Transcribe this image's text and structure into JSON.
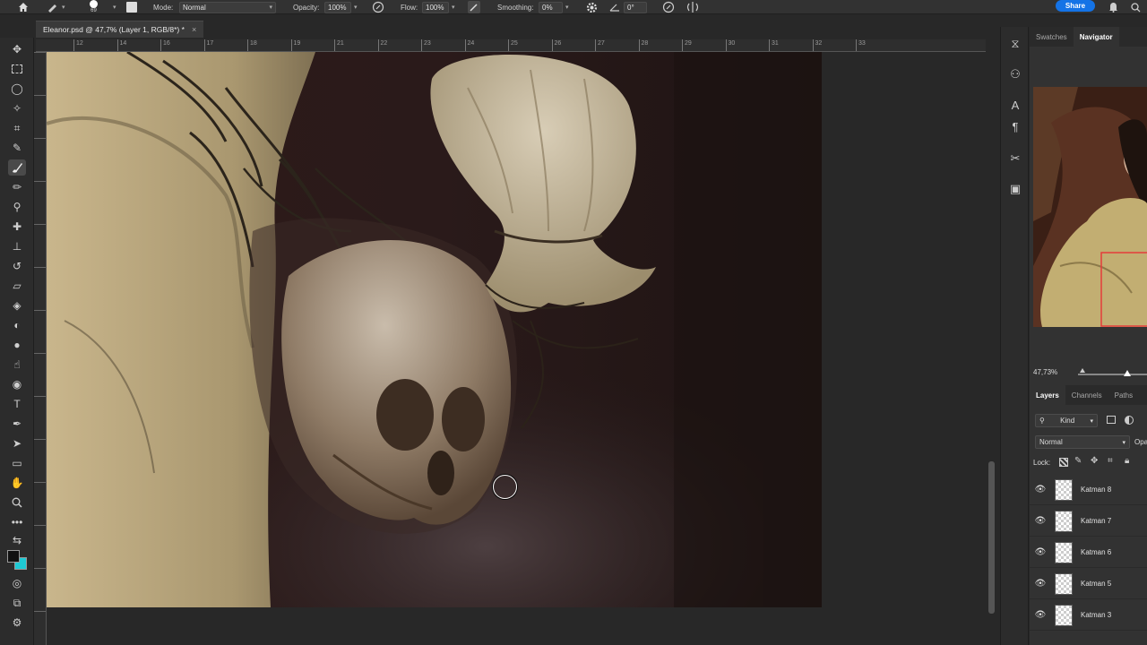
{
  "options_bar": {
    "brush_size": "69",
    "mode_label": "Mode:",
    "mode_value": "Normal",
    "opacity_label": "Opacity:",
    "opacity_value": "100%",
    "flow_label": "Flow:",
    "flow_value": "100%",
    "smoothing_label": "Smoothing:",
    "smoothing_value": "0%",
    "angle_value": "0°",
    "share_label": "Share"
  },
  "document": {
    "tab_title": "Eleanor.psd @ 47,7% (Layer 1, RGB/8*) *",
    "close_glyph": "×"
  },
  "ruler": {
    "ticks": [
      "12",
      "14",
      "16",
      "17",
      "18",
      "19",
      "21",
      "22",
      "23",
      "24",
      "25",
      "26",
      "27",
      "28",
      "29",
      "30",
      "31",
      "32",
      "33"
    ]
  },
  "panel_top": {
    "tabs": [
      "Swatches",
      "Navigator"
    ],
    "active_tab": "Navigator",
    "zoom": "47,73%"
  },
  "layers_panel": {
    "tabs": [
      "Layers",
      "Channels",
      "Paths"
    ],
    "kind_label": "Kind",
    "blend_mode": "Normal",
    "opacity_label": "Opa",
    "lock_label": "Lock:",
    "layers": [
      {
        "name": "Katman 8"
      },
      {
        "name": "Katman 7"
      },
      {
        "name": "Katman 6"
      },
      {
        "name": "Katman 5"
      },
      {
        "name": "Katman 3"
      }
    ]
  },
  "colors": {
    "foreground": "#111111",
    "background": "#1fc9d4",
    "accent": "#1473e6"
  }
}
